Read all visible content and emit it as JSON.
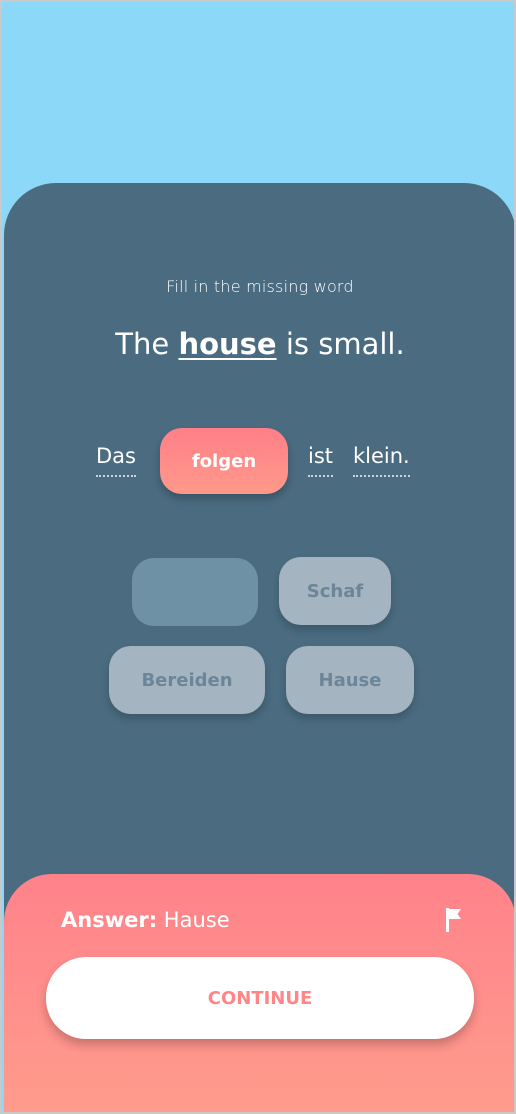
{
  "exercise": {
    "instruction": "Fill in the missing word",
    "sentence_before": "The ",
    "sentence_highlight": "house",
    "sentence_after": " is small."
  },
  "german_sentence": {
    "word1": "Das",
    "slot_word": "folgen",
    "word3": "ist",
    "word4": "klein."
  },
  "choices": {
    "chip2": "Schaf",
    "chip3": "Bereiden",
    "chip4": "Hause"
  },
  "feedback": {
    "answer_label": "Answer:",
    "answer_value": " Hause",
    "continue_label": "CONTINUE"
  },
  "colors": {
    "sky": "#8cd8f8",
    "card": "#4a6b80",
    "accent": "#ff828a",
    "chip": "#a4b5c1"
  },
  "icons": {
    "flag": "flag-icon"
  }
}
